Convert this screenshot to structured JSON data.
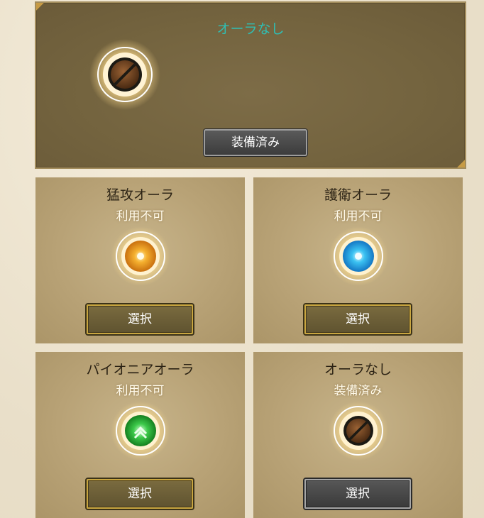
{
  "current": {
    "title": "オーラなし",
    "icon": "no-aura-icon",
    "button_label": "装備済み"
  },
  "cards": [
    {
      "name": "猛攻オーラ",
      "status": "利用不可",
      "icon": "onslaught-aura-icon",
      "button_label": "選択",
      "color": "#f2a624"
    },
    {
      "name": "護衛オーラ",
      "status": "利用不可",
      "icon": "guard-aura-icon",
      "button_label": "選択",
      "color": "#2fb6f0"
    },
    {
      "name": "パイオニアオーラ",
      "status": "利用不可",
      "icon": "pioneer-aura-icon",
      "button_label": "選択",
      "color": "#3cc94a"
    },
    {
      "name": "オーラなし",
      "status": "装備済み",
      "icon": "no-aura-icon",
      "button_label": "選択",
      "color": "#6b3f1c"
    }
  ],
  "colors": {
    "title_teal": "#2fbfb4",
    "gold_border": "#c9a640",
    "panel_dark": "#74643f"
  }
}
